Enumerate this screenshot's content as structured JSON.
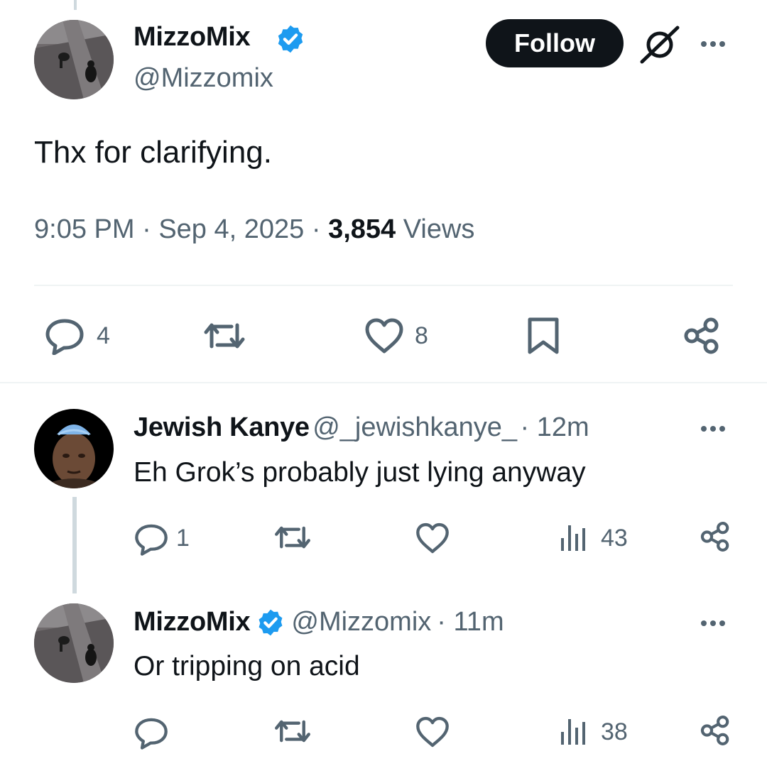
{
  "main_tweet": {
    "author_name": "MizzoMix",
    "handle": "@Mizzomix",
    "follow_label": "Follow",
    "text": "Thx for clarifying.",
    "time": "9:05 PM",
    "date": "Sep 4, 2025",
    "views_count": "3,854",
    "views_label": "Views",
    "separator": "·",
    "actions": {
      "replies": "4",
      "likes": "8"
    }
  },
  "replies": [
    {
      "author_name": "Jewish Kanye",
      "handle": "@_jewishkanye_",
      "time": "· 12m",
      "text": "Eh Grok’s probably just lying anyway",
      "replies": "1",
      "views": "43"
    },
    {
      "author_name": "MizzoMix",
      "handle": "@Mizzomix",
      "time": "· 11m",
      "text": "Or tripping on acid",
      "views": "38"
    }
  ],
  "colors": {
    "verified": "#1d9bf0",
    "text": "#0f1419",
    "muted": "#536471",
    "follow_bg": "#0f1419"
  }
}
